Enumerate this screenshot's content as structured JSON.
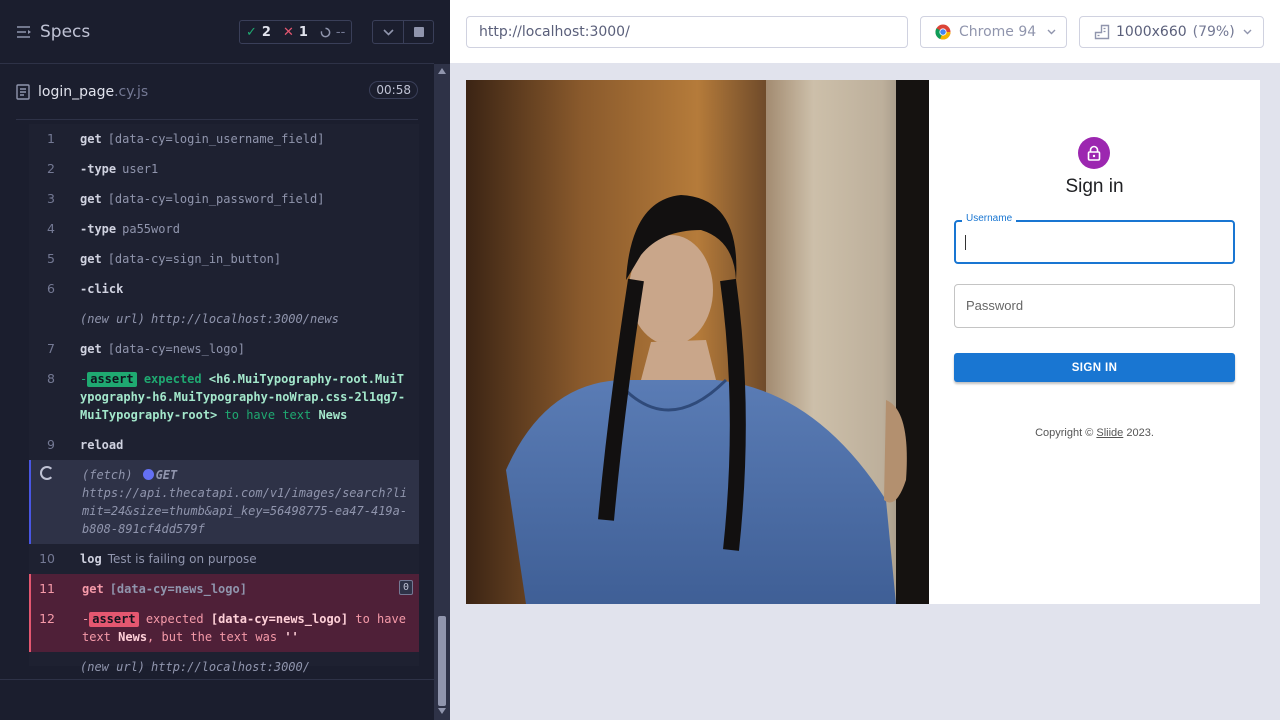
{
  "reporter": {
    "specs_label": "Specs",
    "stats": {
      "passed": "2",
      "failed": "1",
      "pending": "--"
    },
    "spec": {
      "name": "login_page",
      "ext": ".cy.js",
      "duration": "00:58"
    },
    "commands": [
      {
        "num": "1",
        "name": "get",
        "msg": "[data-cy=login_username_field]"
      },
      {
        "num": "2",
        "name": "-type",
        "msg": "user1"
      },
      {
        "num": "3",
        "name": "get",
        "msg": "[data-cy=login_password_field]"
      },
      {
        "num": "4",
        "name": "-type",
        "msg": "pa55word"
      },
      {
        "num": "5",
        "name": "get",
        "msg": "[data-cy=sign_in_button]"
      },
      {
        "num": "6",
        "name": "-click",
        "msg": ""
      },
      {
        "num": "",
        "name": "(new url)",
        "msg": "http://localhost:3000/news"
      },
      {
        "num": "7",
        "name": "get",
        "msg": "[data-cy=news_logo]"
      },
      {
        "num": "8",
        "prefix": "-",
        "badge": "assert",
        "expected": "expected",
        "subject": "<h6.MuiTypography-root.MuiTypography-h6.MuiTypography-noWrap.css-2l1qg7-MuiTypography-root>",
        "to_have": "to have text",
        "value": "News"
      },
      {
        "num": "9",
        "name": "reload",
        "msg": ""
      },
      {
        "num": "",
        "name": "(fetch)",
        "method": "GET",
        "url": "https://api.thecatapi.com/v1/images/search?limit=24&size=thumb&api_key=56498775-ea47-419a-b808-891cf4dd579f"
      },
      {
        "num": "10",
        "name": "log",
        "msg": "Test is failing on purpose"
      },
      {
        "num": "11",
        "name": "get",
        "msg": "[data-cy=news_logo]",
        "count": "0"
      },
      {
        "num": "12",
        "prefix": "-",
        "badge": "assert",
        "expected": "expected",
        "subject": "[data-cy=news_logo]",
        "to_have": "to have text",
        "value": "News",
        "but": ", but the text was",
        "actual": "''"
      },
      {
        "num": "",
        "name": "(new url)",
        "msg": "http://localhost:3000/"
      }
    ]
  },
  "aut": {
    "url": "http://localhost:3000/",
    "browser": "Chrome 94",
    "viewport": "1000x660",
    "zoom": "(79%)",
    "signin": {
      "title": "Sign in",
      "username_label": "Username",
      "password_label": "Password",
      "button": "SIGN IN",
      "copyright_prefix": "Copyright © ",
      "copyright_link": "Sliide",
      "copyright_suffix": " 2023."
    }
  },
  "colors": {
    "pass": "#1fa971",
    "fail": "#e45770",
    "primary": "#1976d2",
    "avatar": "#9c27b0"
  }
}
